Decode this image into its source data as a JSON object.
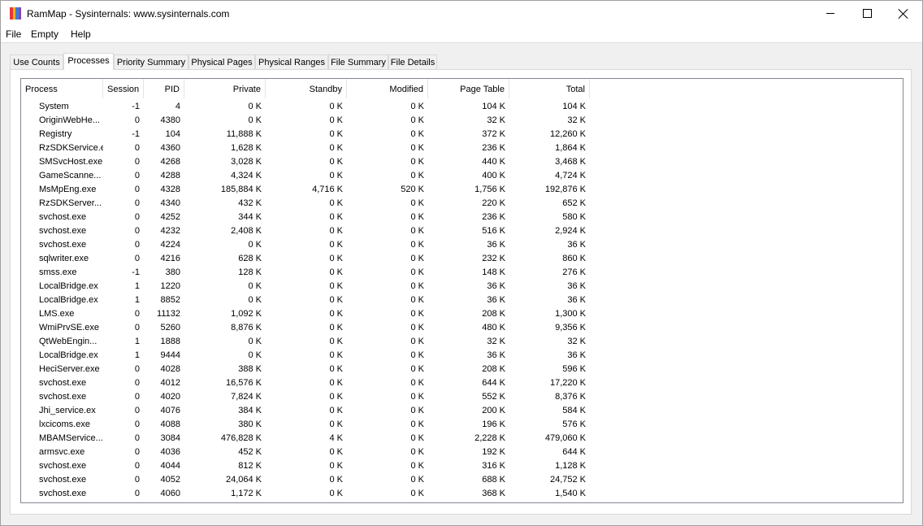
{
  "window": {
    "title": "RamMap - Sysinternals: www.sysinternals.com",
    "icon_colors": [
      "#e8363a",
      "#f6b21b",
      "#3a7fd5",
      "#8e44ad"
    ]
  },
  "menu": [
    {
      "label": "File"
    },
    {
      "label": "Empty"
    },
    {
      "label": "Help"
    }
  ],
  "tabs": [
    {
      "label": "Use Counts"
    },
    {
      "label": "Processes",
      "active": true
    },
    {
      "label": "Priority Summary"
    },
    {
      "label": "Physical Pages"
    },
    {
      "label": "Physical Ranges"
    },
    {
      "label": "File Summary"
    },
    {
      "label": "File Details"
    }
  ],
  "table": {
    "columns": [
      "Process",
      "Session",
      "PID",
      "Private",
      "Standby",
      "Modified",
      "Page Table",
      "Total"
    ],
    "rows": [
      [
        "System",
        "-1",
        "4",
        "0 K",
        "0 K",
        "0 K",
        "104 K",
        "104 K"
      ],
      [
        "OriginWebHe...",
        "0",
        "4380",
        "0 K",
        "0 K",
        "0 K",
        "32 K",
        "32 K"
      ],
      [
        "Registry",
        "-1",
        "104",
        "11,888 K",
        "0 K",
        "0 K",
        "372 K",
        "12,260 K"
      ],
      [
        "RzSDKService.e",
        "0",
        "4360",
        "1,628 K",
        "0 K",
        "0 K",
        "236 K",
        "1,864 K"
      ],
      [
        "SMSvcHost.exe",
        "0",
        "4268",
        "3,028 K",
        "0 K",
        "0 K",
        "440 K",
        "3,468 K"
      ],
      [
        "GameScanne...",
        "0",
        "4288",
        "4,324 K",
        "0 K",
        "0 K",
        "400 K",
        "4,724 K"
      ],
      [
        "MsMpEng.exe",
        "0",
        "4328",
        "185,884 K",
        "4,716 K",
        "520 K",
        "1,756 K",
        "192,876 K"
      ],
      [
        "RzSDKServer...",
        "0",
        "4340",
        "432 K",
        "0 K",
        "0 K",
        "220 K",
        "652 K"
      ],
      [
        "svchost.exe",
        "0",
        "4252",
        "344 K",
        "0 K",
        "0 K",
        "236 K",
        "580 K"
      ],
      [
        "svchost.exe",
        "0",
        "4232",
        "2,408 K",
        "0 K",
        "0 K",
        "516 K",
        "2,924 K"
      ],
      [
        "svchost.exe",
        "0",
        "4224",
        "0 K",
        "0 K",
        "0 K",
        "36 K",
        "36 K"
      ],
      [
        "sqlwriter.exe",
        "0",
        "4216",
        "628 K",
        "0 K",
        "0 K",
        "232 K",
        "860 K"
      ],
      [
        "smss.exe",
        "-1",
        "380",
        "128 K",
        "0 K",
        "0 K",
        "148 K",
        "276 K"
      ],
      [
        "LocalBridge.ex",
        "1",
        "1220",
        "0 K",
        "0 K",
        "0 K",
        "36 K",
        "36 K"
      ],
      [
        "LocalBridge.ex",
        "1",
        "8852",
        "0 K",
        "0 K",
        "0 K",
        "36 K",
        "36 K"
      ],
      [
        "LMS.exe",
        "0",
        "11132",
        "1,092 K",
        "0 K",
        "0 K",
        "208 K",
        "1,300 K"
      ],
      [
        "WmiPrvSE.exe",
        "0",
        "5260",
        "8,876 K",
        "0 K",
        "0 K",
        "480 K",
        "9,356 K"
      ],
      [
        "QtWebEngin...",
        "1",
        "1888",
        "0 K",
        "0 K",
        "0 K",
        "32 K",
        "32 K"
      ],
      [
        "LocalBridge.ex",
        "1",
        "9444",
        "0 K",
        "0 K",
        "0 K",
        "36 K",
        "36 K"
      ],
      [
        "HeciServer.exe",
        "0",
        "4028",
        "388 K",
        "0 K",
        "0 K",
        "208 K",
        "596 K"
      ],
      [
        "svchost.exe",
        "0",
        "4012",
        "16,576 K",
        "0 K",
        "0 K",
        "644 K",
        "17,220 K"
      ],
      [
        "svchost.exe",
        "0",
        "4020",
        "7,824 K",
        "0 K",
        "0 K",
        "552 K",
        "8,376 K"
      ],
      [
        "Jhi_service.ex",
        "0",
        "4076",
        "384 K",
        "0 K",
        "0 K",
        "200 K",
        "584 K"
      ],
      [
        "lxcicoms.exe",
        "0",
        "4088",
        "380 K",
        "0 K",
        "0 K",
        "196 K",
        "576 K"
      ],
      [
        "MBAMService...",
        "0",
        "3084",
        "476,828 K",
        "4 K",
        "0 K",
        "2,228 K",
        "479,060 K"
      ],
      [
        "armsvc.exe",
        "0",
        "4036",
        "452 K",
        "0 K",
        "0 K",
        "192 K",
        "644 K"
      ],
      [
        "svchost.exe",
        "0",
        "4044",
        "812 K",
        "0 K",
        "0 K",
        "316 K",
        "1,128 K"
      ],
      [
        "svchost.exe",
        "0",
        "4052",
        "24,064 K",
        "0 K",
        "0 K",
        "688 K",
        "24,752 K"
      ],
      [
        "svchost.exe",
        "0",
        "4060",
        "1,172 K",
        "0 K",
        "0 K",
        "368 K",
        "1,540 K"
      ]
    ]
  },
  "scrollbar": {
    "up_icon": "scroll-up-arrow-icon",
    "down_icon": "scroll-down-arrow-icon"
  }
}
